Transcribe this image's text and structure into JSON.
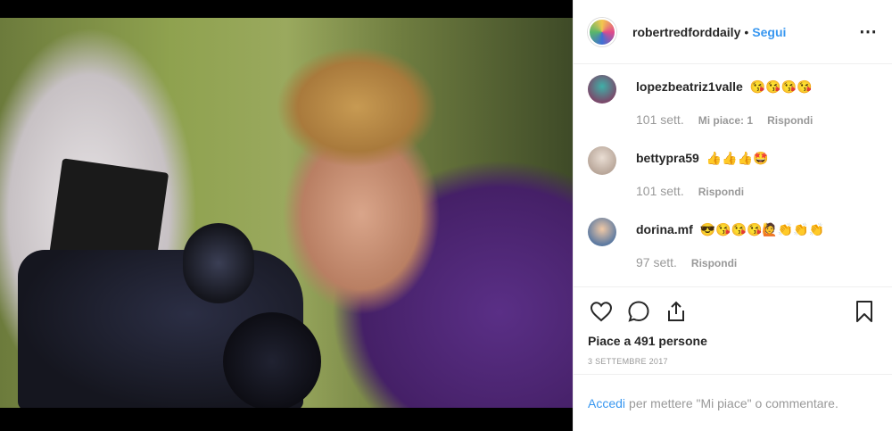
{
  "post": {
    "photo_alt": "",
    "author": {
      "username": "robertredforddaily",
      "separator": "•",
      "follow_label": "Segui",
      "more_icon": "more-dots-icon"
    },
    "comments": [
      {
        "username": "lopezbeatriz1valle",
        "text": "😘😘😘😘",
        "time": "101 sett.",
        "likes": "Mi piace: 1",
        "reply": "Rispondi",
        "avatar_color": "#7a4a6b"
      },
      {
        "username": "bettypra59",
        "text": "👍👍👍🤩",
        "time": "101 sett.",
        "likes": "",
        "reply": "Rispondi",
        "avatar_color": "#b9a79a"
      },
      {
        "username": "dorina.mf",
        "text": "😎😘😘😘🙋👏👏👏",
        "time": "97 sett.",
        "likes": "",
        "reply": "Rispondi",
        "avatar_color": "#5d7aa1"
      }
    ],
    "actions": {
      "like_icon": "heart-icon",
      "comment_icon": "comment-bubble-icon",
      "share_icon": "share-icon",
      "save_icon": "bookmark-icon"
    },
    "likes_text": "Piace a 491 persone",
    "date": "3 settembre 2017",
    "login": {
      "link": "Accedi",
      "rest": "per mettere \"Mi piace\" o commentare."
    }
  }
}
